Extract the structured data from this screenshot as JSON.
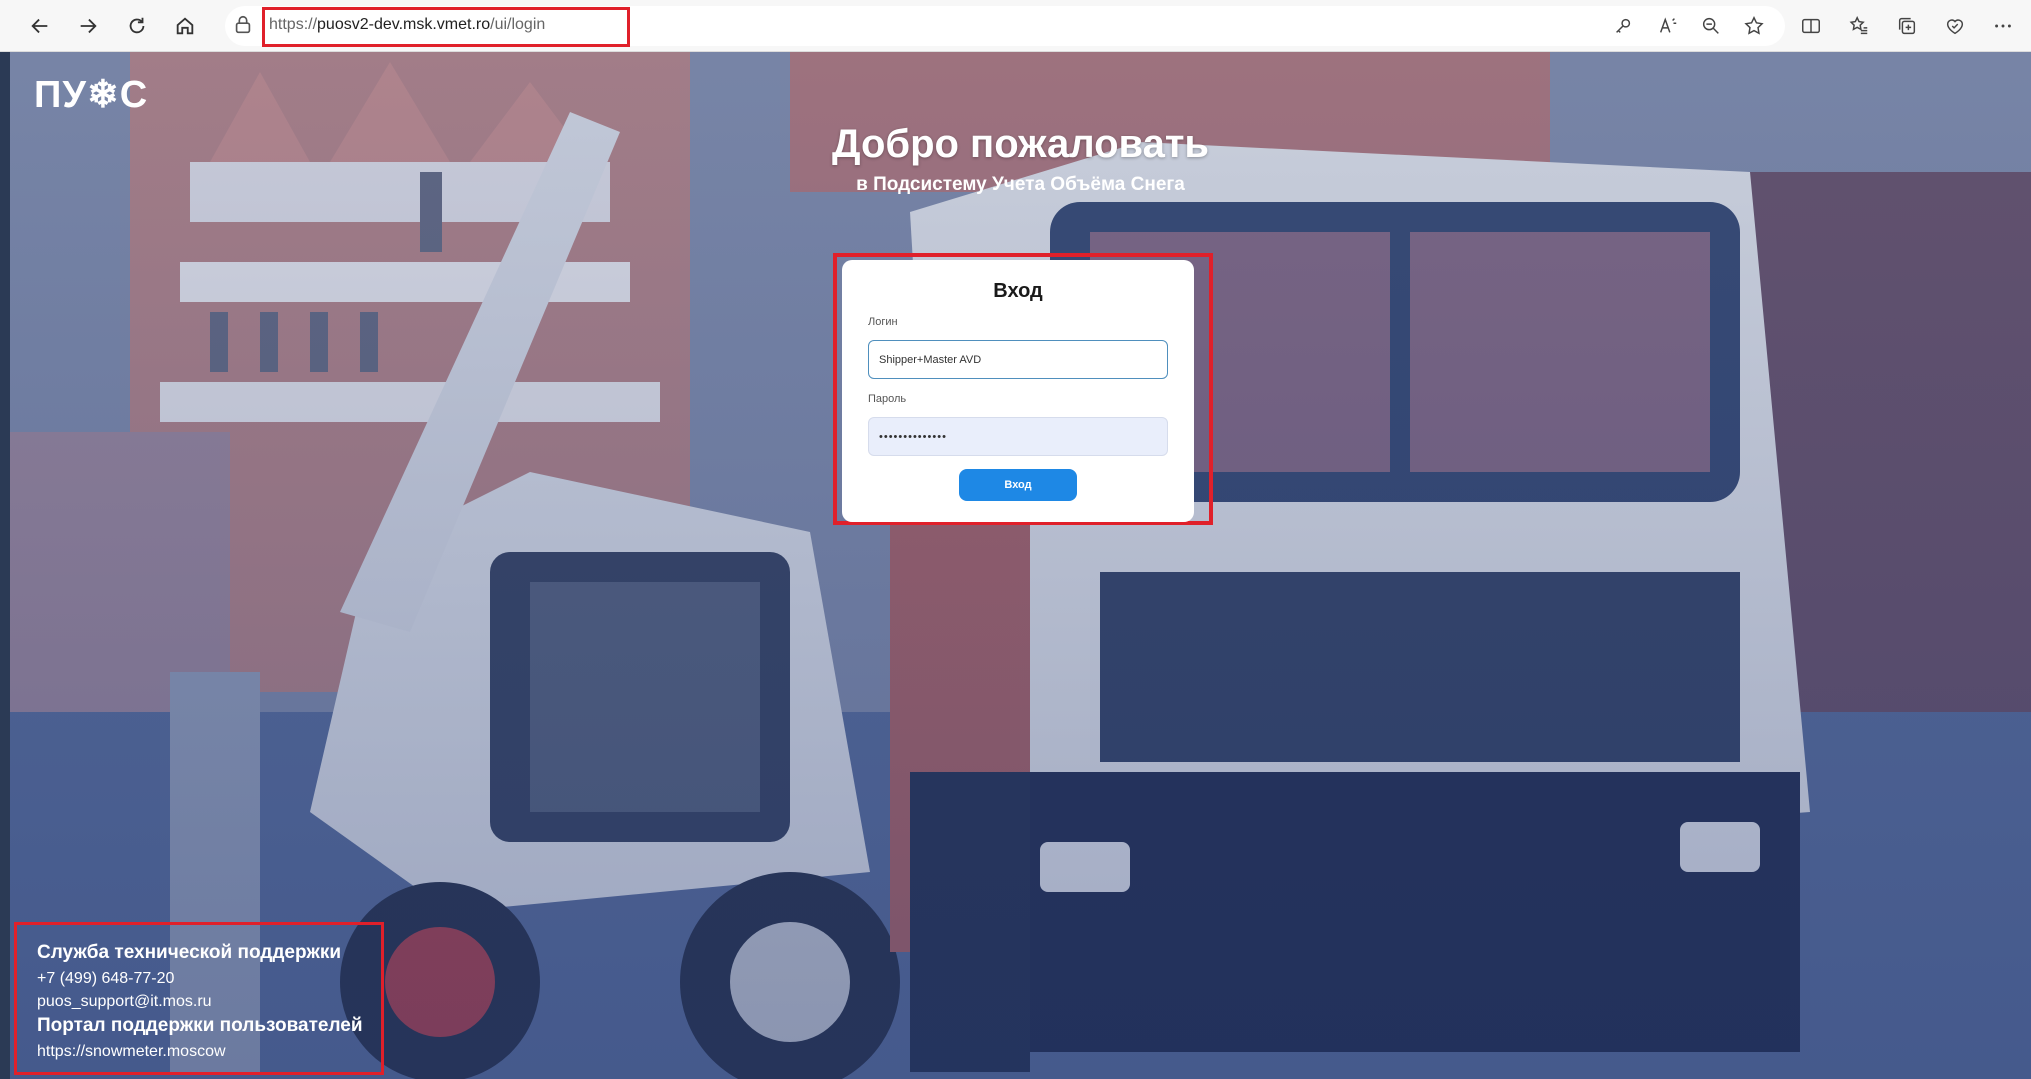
{
  "browser": {
    "url_prefix": "https://",
    "url_domain": "puosv2-dev.msk.vmet.ro",
    "url_path": "/ui/login",
    "icons": [
      "back-icon",
      "forward-icon",
      "refresh-icon",
      "home-icon",
      "lock-icon",
      "key-icon",
      "read-aloud-icon",
      "zoom-icon",
      "favorite-icon",
      "split-screen-icon",
      "favorites-icon",
      "collections-icon",
      "browser-essentials-icon",
      "more-icon"
    ]
  },
  "page": {
    "logo_text": "ПУ❄С",
    "welcome_title": "Добро пожаловать",
    "welcome_subtitle": "в Подсистему Учета Объёма Снега"
  },
  "login_form": {
    "title": "Вход",
    "login_label": "Логин",
    "login_value": "Shipper+Master AVD",
    "password_label": "Пароль",
    "password_value": "••••••••••••••",
    "submit_label": "Вход"
  },
  "support": {
    "title": "Служба технической поддержки",
    "phone": "+7 (499) 648-77-20",
    "email": "puos_support@it.mos.ru",
    "portal_title": "Портал поддержки пользователей",
    "portal_url": "https://snowmeter.moscow"
  },
  "colors": {
    "highlight": "#e0202a",
    "primary_button": "#1e88e5",
    "input_border_focus": "#4f8fbd",
    "password_bg": "#e9eefb"
  }
}
